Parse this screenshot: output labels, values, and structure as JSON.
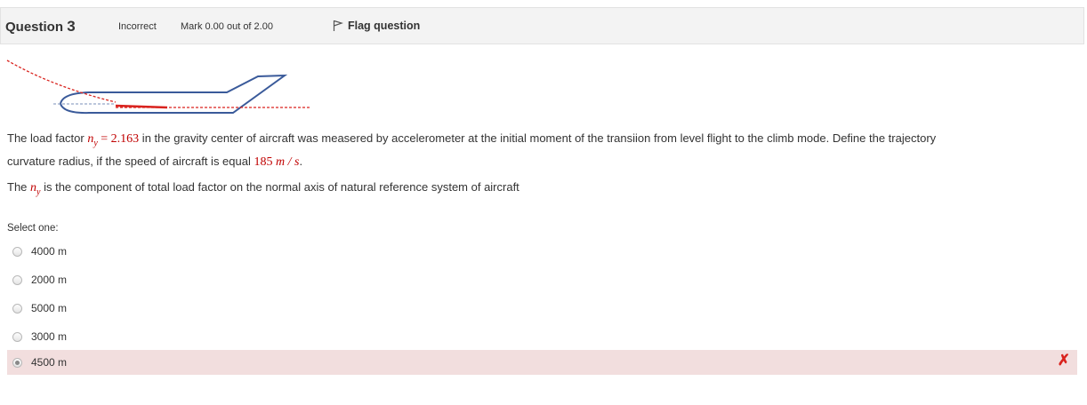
{
  "header": {
    "question_word": "Question",
    "question_number": "3",
    "state": "Incorrect",
    "grade": "Mark 0.00 out of 2.00",
    "flag_label": "Flag question"
  },
  "question": {
    "line1_a": "The load factor ",
    "n_symbol": "n",
    "n_subscript": "y",
    "n_value": " = 2.163",
    "line1_b": " in the gravity center of aircraft was measered by accelerometer at the initial moment of the transiion from level flight to the climb mode.  Define the trajectory",
    "line2_a": "curvature radius, if the speed of aircraft is equal ",
    "speed_value": "185 ",
    "speed_unit": "m / s",
    "speed_period": ".",
    "line3_a": "The ",
    "line3_b": " is the component of total load factor on the normal axis of natural reference system of aircraft"
  },
  "answer": {
    "prompt": "Select one:",
    "options": [
      {
        "label": "4000 m",
        "selected": false
      },
      {
        "label": "2000 m",
        "selected": false
      },
      {
        "label": "5000 m",
        "selected": false
      },
      {
        "label": "3000 m",
        "selected": false
      },
      {
        "label": "4500 m",
        "selected": true,
        "status": "incorrect"
      }
    ],
    "incorrect_mark": "✗"
  },
  "colors": {
    "aircraft_outline": "#3a5a9a",
    "trajectory": "#d9231e",
    "incorrect_bg": "#f2dede"
  }
}
